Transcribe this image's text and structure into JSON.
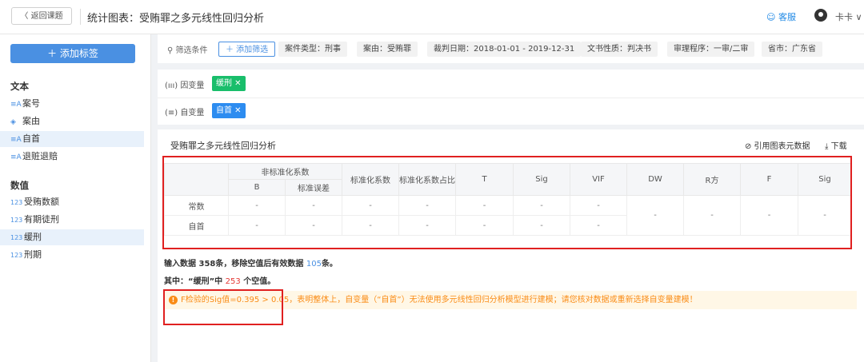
{
  "header": {
    "back_label": "〈 返回课题",
    "title": "统计图表：受贿罪之多元线性回归分析",
    "help_label": "☺ 客服",
    "user_name": "卡卡 ∨"
  },
  "sidebar": {
    "add_tag_label": "＋  添加标签",
    "section_text": "文本",
    "text_items": [
      {
        "icon": "≡A",
        "label": "案号"
      },
      {
        "icon": "◈",
        "label": "案由"
      },
      {
        "icon": "≡A",
        "label": "自首"
      },
      {
        "icon": "≡A",
        "label": "退赃退赔"
      }
    ],
    "section_numeric": "数值",
    "numeric_items": [
      {
        "icon": "123",
        "label": "受贿数额"
      },
      {
        "icon": "123",
        "label": "有期徒刑"
      },
      {
        "icon": "123",
        "label": "缓刑"
      },
      {
        "icon": "123",
        "label": "刑期"
      }
    ]
  },
  "filters": {
    "label": "⚲ 筛选条件",
    "add_label": "＋ 添加筛选",
    "chips": [
      "案件类型：刑事",
      "案由：受贿罪",
      "裁判日期：2018-01-01 - 2019-12-31",
      "文书性质：判决书",
      "审理程序：一审/二审",
      "省市：广东省"
    ]
  },
  "variables": {
    "dependent_label": "(ııı) 因变量",
    "dependent_tag": "缓刑 ✕",
    "dependent_color": "#19be6b",
    "independent_label": "(≡) 自变量",
    "independent_tag": "自首 ✕",
    "independent_color": "#2d8cf0"
  },
  "result": {
    "title": "受贿罪之多元线性回归分析",
    "cite_label": "⊘ 引用图表元数据",
    "download_label": "⤓ 下载",
    "table": {
      "group_header": "非标准化系数",
      "sub_b": "B",
      "sub_se": "标准误差",
      "h_std": "标准化系数",
      "h_std_share": "标准化系数占比",
      "h_t": "T",
      "h_sig": "Sig",
      "h_vif": "VIF",
      "h_dw": "DW",
      "h_r2": "R方",
      "h_f": "F",
      "h_sig2": "Sig",
      "rows": [
        {
          "name": "常数",
          "values": [
            "-",
            "-",
            "-",
            "-",
            "-",
            "-",
            "-"
          ]
        },
        {
          "name": "自首",
          "values": [
            "-",
            "-",
            "-",
            "-",
            "-",
            "-",
            "-"
          ]
        }
      ],
      "merged_values": [
        "-",
        "-",
        "-",
        "-"
      ]
    },
    "summary": {
      "prefix": "输入数据 358条，移除空值后有效数据 ",
      "valid_count": "105",
      "suffix": "条。"
    },
    "nulls": {
      "prefix": "其中：“缓刑”中 ",
      "count": "253",
      "suffix": " 个空值。"
    },
    "warning": "F检验的Sig值=0.395 > 0.05，表明整体上，自变量（“自首”）无法使用多元线性回归分析模型进行建模；请您核对数据或重新选择自变量建模！"
  }
}
